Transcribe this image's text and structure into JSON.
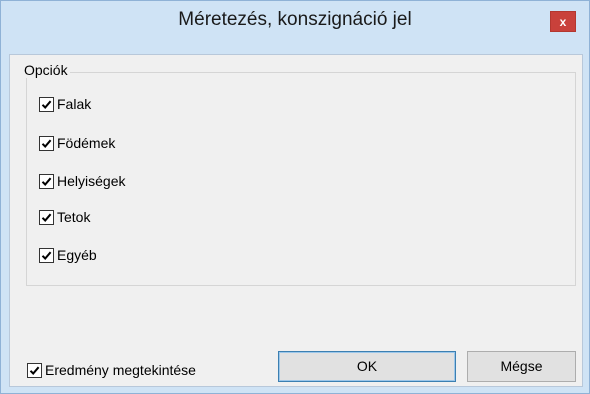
{
  "window": {
    "title": "Méretezés, konszignáció jel",
    "close_label": "x"
  },
  "options": {
    "group_label": "Opciók",
    "items": [
      {
        "label": "Falak",
        "checked": true
      },
      {
        "label": "Födémek",
        "checked": true
      },
      {
        "label": "Helyiségek",
        "checked": true
      },
      {
        "label": "Tetok",
        "checked": true
      },
      {
        "label": "Egyéb",
        "checked": true
      }
    ]
  },
  "footer": {
    "preview_label": "Eredmény megtekintése",
    "preview_checked": true,
    "ok_label": "OK",
    "cancel_label": "Mégse"
  },
  "colors": {
    "frame": "#cfe3f5",
    "close_button": "#c9413b",
    "client_background": "#f0f0f0"
  }
}
